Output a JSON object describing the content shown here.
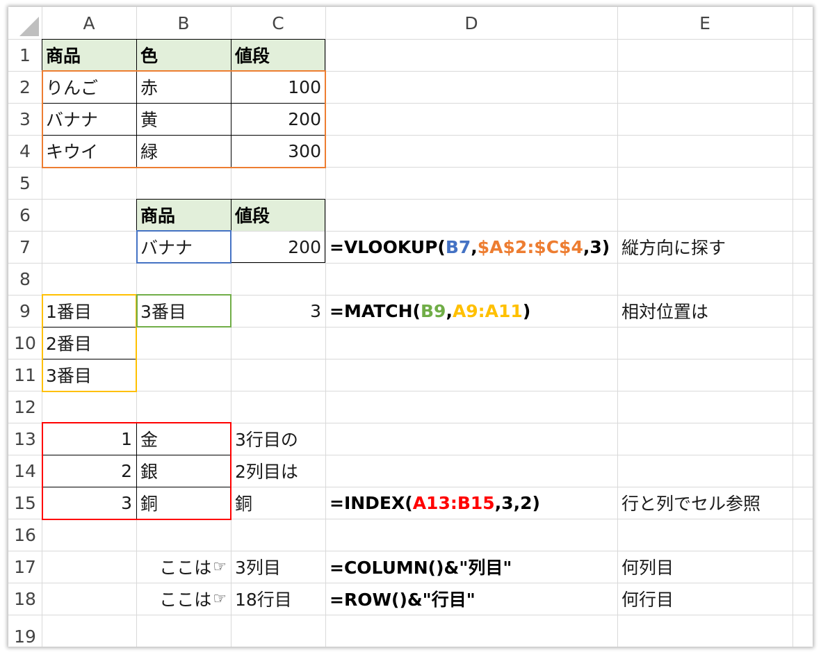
{
  "columns": [
    "A",
    "B",
    "C",
    "D",
    "E"
  ],
  "rows": [
    "1",
    "2",
    "3",
    "4",
    "5",
    "6",
    "7",
    "8",
    "9",
    "10",
    "11",
    "12",
    "13",
    "14",
    "15",
    "16",
    "17",
    "18",
    "19"
  ],
  "colors": {
    "header_fill": "#e2efda",
    "ref_blue": "#4472c4",
    "ref_orange": "#ed7d31",
    "ref_green": "#70ad47",
    "ref_yellow": "#ffc000",
    "ref_red": "#ff0000"
  },
  "cells": {
    "A1": "商品",
    "B1": "色",
    "C1": "値段",
    "A2": "りんご",
    "B2": "赤",
    "C2": "100",
    "A3": "バナナ",
    "B3": "黄",
    "C3": "200",
    "A4": "キウイ",
    "B4": "緑",
    "C4": "300",
    "B6": "商品",
    "C6": "値段",
    "B7": "バナナ",
    "C7": "200",
    "E7": "縦方向に探す",
    "A9": "1番目",
    "B9": "3番目",
    "C9": "3",
    "E9": "相対位置は",
    "A10": "2番目",
    "A11": "3番目",
    "A13": "1",
    "B13": "金",
    "C13": "3行目の",
    "A14": "2",
    "B14": "銀",
    "C14": "2列目は",
    "A15": "3",
    "B15": "銅",
    "C15": "銅",
    "E15": "行と列でセル参照",
    "B17": "ここは",
    "C17": "3列目",
    "E17": "何列目",
    "B18": "ここは",
    "C18": "18行目",
    "E18": "何行目"
  },
  "hand_icon": "☞",
  "formulas": {
    "D7": {
      "pre": "=VLOOKUP(",
      "r1": "B7",
      "s1": ",",
      "r2": "$A$2:$C$4",
      "post": ",3)"
    },
    "D9": {
      "pre": "=MATCH(",
      "r1": "B9",
      "s1": ",",
      "r2": "A9:A11",
      "post": ")"
    },
    "D15": {
      "pre": "=INDEX(",
      "r1": "A13:B15",
      "post": ",3,2)"
    },
    "D17": "=COLUMN()&\"列目\"",
    "D18": "=ROW()&\"行目\""
  }
}
